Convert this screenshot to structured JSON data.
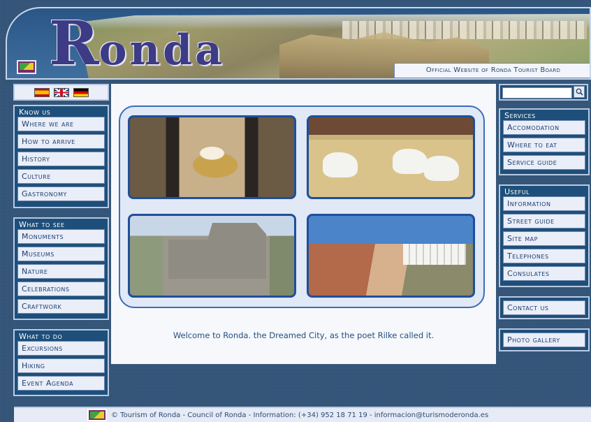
{
  "header": {
    "logo_initial": "R",
    "logo_rest": "onda",
    "subtitle": "Official Website of Ronda Tourist Board"
  },
  "languages": [
    "Spanish",
    "English",
    "German"
  ],
  "left_menu": [
    {
      "title": "Know us",
      "items": [
        "Where we are",
        "How to arrive",
        "History",
        "Culture",
        "Gastronomy"
      ]
    },
    {
      "title": "What to see",
      "items": [
        "Monuments",
        "Museums",
        "Nature",
        "Celebrations",
        "Craftwork"
      ]
    },
    {
      "title": "What to do",
      "items": [
        "Excursions",
        "Hiking",
        "Event Agenda"
      ]
    }
  ],
  "right_menu": [
    {
      "title": "Services",
      "items": [
        "Accomodation",
        "Where to eat",
        "Service guide"
      ]
    },
    {
      "title": "Useful",
      "items": [
        "Information",
        "Street guide",
        "Site map",
        "Telephones",
        "Consulates"
      ]
    }
  ],
  "right_links": {
    "contact": "Contact us",
    "gallery": "Photo gallery"
  },
  "search": {
    "placeholder": ""
  },
  "main": {
    "welcome": "Welcome to Ronda. the Dreamed City, as the poet Rilke called it."
  },
  "footer": {
    "text": "© Tourism of Ronda - Council of Ronda - Information: (+34) 952 18 71 19 - informacion@turismoderonda.es"
  },
  "colors": {
    "page_bg": "#2a4d72",
    "panel_bg": "#1e4f7a",
    "item_bg": "#e9eef8",
    "logo_text": "#3d3b86",
    "gallery_border": "#3d6db4"
  },
  "icons": {
    "search": "magnifier-icon",
    "flag": "ronda-flag-icon"
  }
}
